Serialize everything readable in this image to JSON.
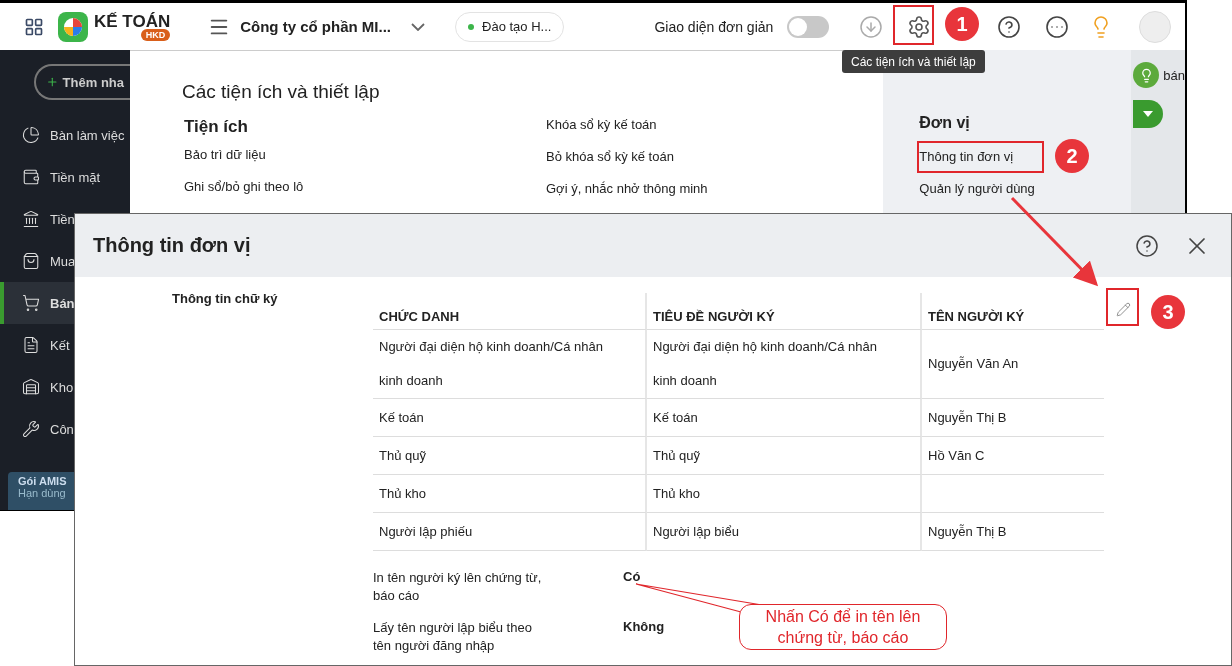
{
  "app": {
    "logo": {
      "name": "KẾ TOÁN",
      "badge": "HKD"
    },
    "company": "Công ty cổ phần MI...",
    "branch": "Đào tạo H...",
    "simple_mode": {
      "label": "Giao diện đơn giản",
      "on": false
    },
    "tooltip": "Các tiện ích và thiết lập",
    "sidebar": {
      "add_button": "Thêm nha",
      "items": [
        {
          "label": "Bàn làm việc",
          "selected": false
        },
        {
          "label": "Tiền mặt",
          "selected": false
        },
        {
          "label": "Tiền",
          "selected": false
        },
        {
          "label": "Mua",
          "selected": false
        },
        {
          "label": "Bán",
          "selected": true
        },
        {
          "label": "Kết",
          "selected": false
        },
        {
          "label": "Kho",
          "selected": false
        },
        {
          "label": "Côn",
          "selected": false
        }
      ],
      "plan": {
        "title": "Gói AMIS",
        "subtitle": "Hạn dùng"
      }
    },
    "settings": {
      "title": "Các tiện ích và thiết lập",
      "utilities": {
        "heading": "Tiện ích",
        "items": [
          "Bảo trì dữ liệu",
          "Ghi sổ/bỏ ghi theo lô"
        ]
      },
      "column_2": [
        "Khóa sổ kỳ kế toán",
        "Bỏ khóa sổ kỳ kế toán",
        "Gợi ý, nhắc nhở thông minh"
      ],
      "unit": {
        "heading": "Đơn vị",
        "items": [
          "Thông tin đơn vị",
          "Quản lý người dùng"
        ]
      }
    },
    "background_text": "bán"
  },
  "dialog": {
    "title": "Thông tin đơn vị",
    "section_label": "Thông tin chữ ký",
    "columns": [
      "CHỨC DANH",
      "TIÊU ĐỀ NGƯỜI KÝ",
      "TÊN NGƯỜI KÝ"
    ],
    "rows": [
      {
        "position": "Người đại diện hộ kinh doanh/Cá nhân kinh doanh",
        "signer_title": "Người đại diện hộ kinh doanh/Cá nhân kinh doanh",
        "signer_name": "Nguyễn Văn An"
      },
      {
        "position": "Kế toán",
        "signer_title": "Kế toán",
        "signer_name": "Nguyễn Thị B"
      },
      {
        "position": "Thủ quỹ",
        "signer_title": "Thủ quỹ",
        "signer_name": "Hồ Văn C"
      },
      {
        "position": "Thủ kho",
        "signer_title": "Thủ kho"
      },
      {
        "position": "Người lập phiếu",
        "signer_title": "Người lập biểu",
        "signer_name": "Nguyễn Thị B"
      }
    ],
    "options": [
      {
        "label": "In tên người ký lên chứng từ, báo cáo",
        "value": "Có"
      },
      {
        "label": "Lấy tên người lập biểu theo tên người đăng nhập",
        "value": "Không"
      }
    ]
  },
  "annotations": {
    "markers": [
      "1",
      "2",
      "3"
    ],
    "callout": "Nhấn Có để in tên lên chứng từ, báo cáo"
  }
}
